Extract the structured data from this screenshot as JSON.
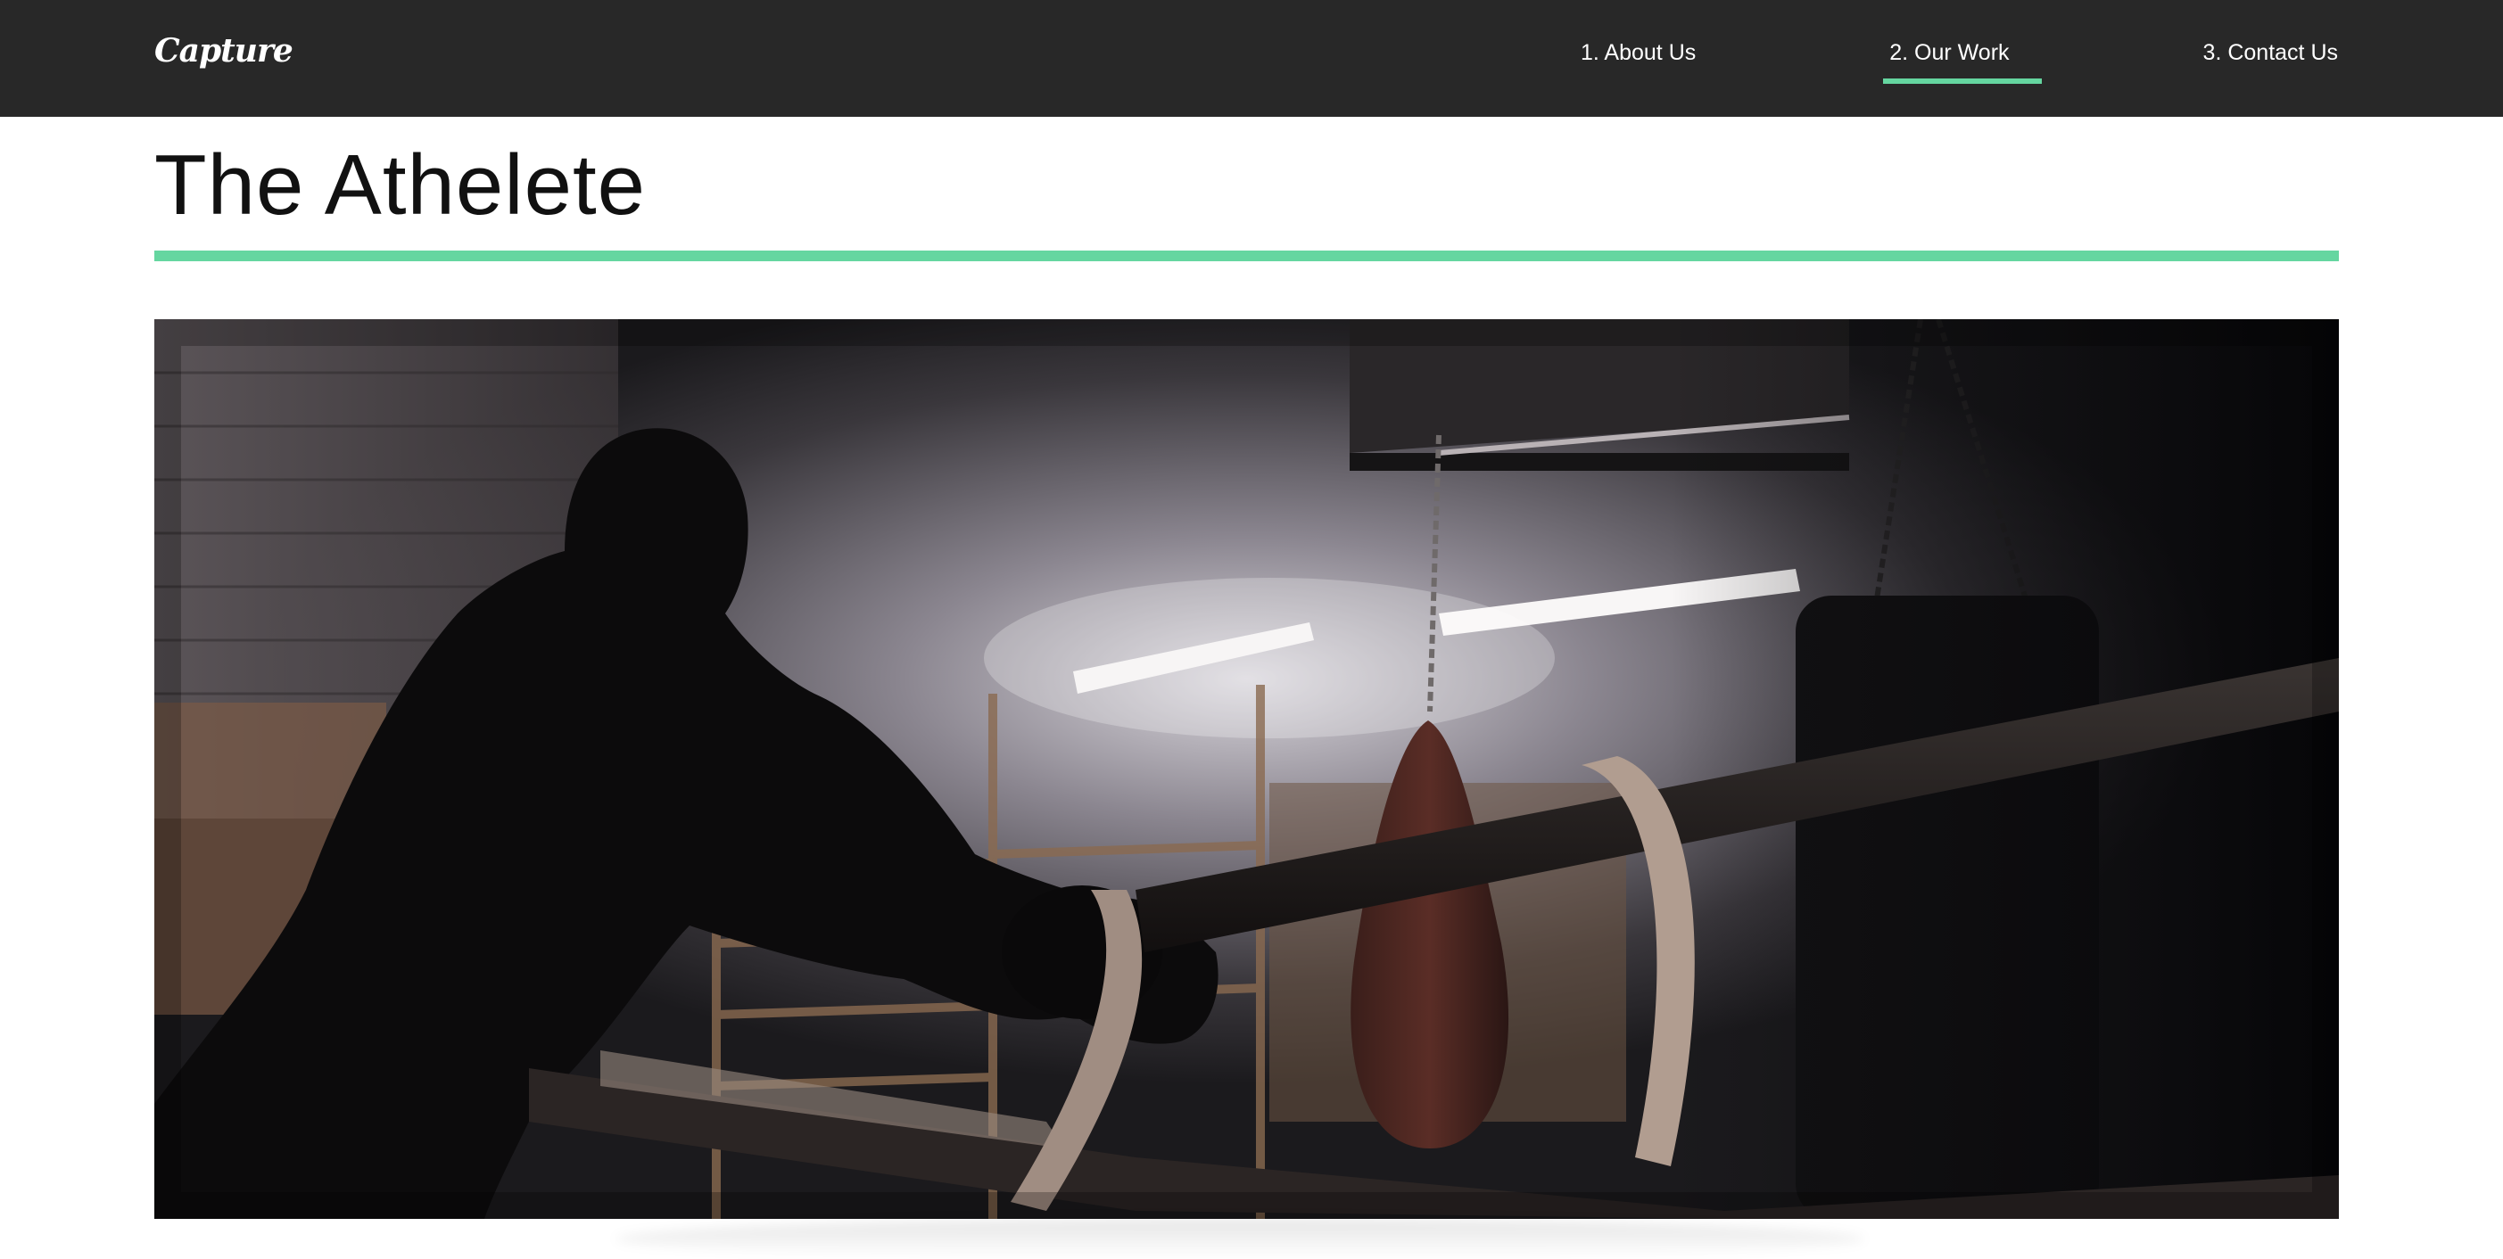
{
  "nav": {
    "logo": "Capture",
    "links": [
      {
        "label": "1. About Us",
        "active": false
      },
      {
        "label": "2. Our Work",
        "active": true
      },
      {
        "label": "3. Contact Us",
        "active": false
      }
    ]
  },
  "page": {
    "title": "The Athelete"
  },
  "hero": {
    "alt": "Boxer leaning on the ropes of a boxing ring in a dim gym"
  },
  "colors": {
    "nav_background": "#282828",
    "accent": "#65d6a0",
    "text": "#111111"
  }
}
